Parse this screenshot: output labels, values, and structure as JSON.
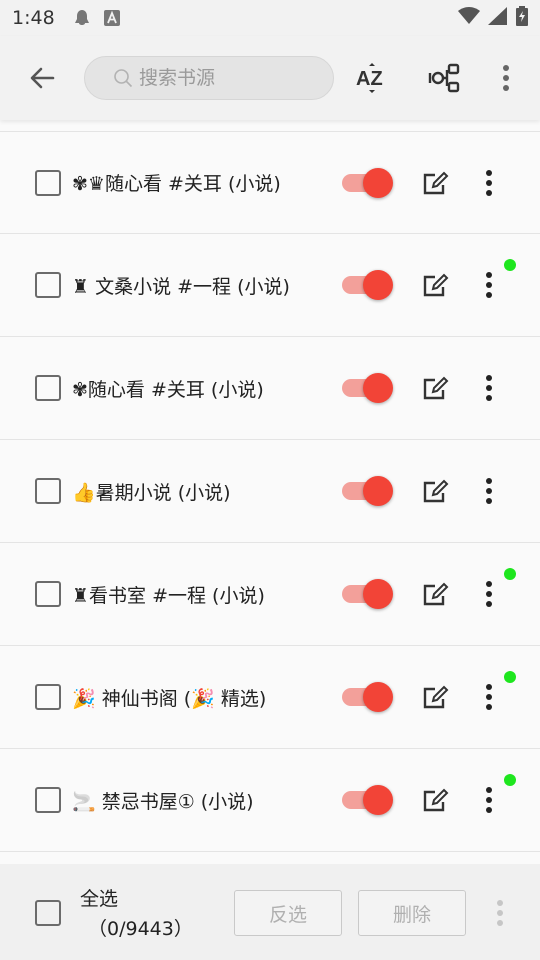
{
  "status_bar": {
    "time": "1:48",
    "icons": [
      "qq-notification-icon",
      "font-a-icon",
      "wifi-icon",
      "signal-icon",
      "battery-icon"
    ]
  },
  "toolbar": {
    "search_placeholder": "搜索书源",
    "sort_label": "AZ"
  },
  "sources": [
    {
      "label": "✾♛随心看 #关耳 (小说)",
      "enabled": true,
      "checked": false,
      "has_dot": false
    },
    {
      "label": "♜ 文桑小说 #一程 (小说)",
      "enabled": true,
      "checked": false,
      "has_dot": true
    },
    {
      "label": "✾随心看 #关耳 (小说)",
      "enabled": true,
      "checked": false,
      "has_dot": false
    },
    {
      "label": "👍暑期小说 (小说)",
      "enabled": true,
      "checked": false,
      "has_dot": false
    },
    {
      "label": "♜看书室 #一程 (小说)",
      "enabled": true,
      "checked": false,
      "has_dot": true
    },
    {
      "label": "🎉 神仙书阁 (🎉 精选)",
      "enabled": true,
      "checked": false,
      "has_dot": true
    },
    {
      "label": "🚬 禁忌书屋① (小说)",
      "enabled": true,
      "checked": false,
      "has_dot": true
    }
  ],
  "bottom_bar": {
    "select_all_label": "全选",
    "count": "（0/9443）",
    "invert_label": "反选",
    "delete_label": "删除"
  },
  "colors": {
    "accent": "#f24437",
    "accent_track": "#f3a09a",
    "new_dot": "#1ee61e"
  }
}
